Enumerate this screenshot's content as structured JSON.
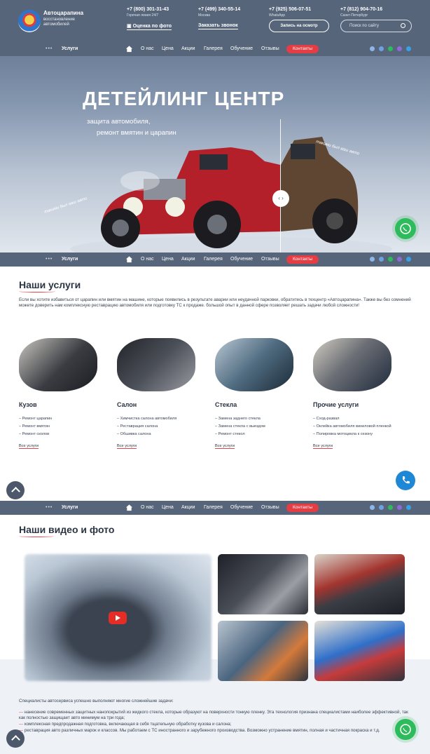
{
  "header": {
    "brand_name": "Автоцарапина",
    "brand_sub": "восстановление автомобилей",
    "phones": [
      {
        "number": "+7 (800) 301-31-43",
        "note": "Горячая линия 24/7"
      },
      {
        "number": "+7 (499) 340-55-14",
        "note": "Москва"
      },
      {
        "number": "+7 (925) 506-07-51",
        "note": "WhatsApp"
      },
      {
        "number": "+7 (812) 904-70-16",
        "note": "Санкт-Петербург"
      }
    ],
    "photo_estimate": "Оценка по фото",
    "callback": "Заказать звонок",
    "appointment_button": "Запись на осмотр",
    "search_placeholder": "Поиск по сайту"
  },
  "nav": {
    "dots": "•••",
    "services": "Услуги",
    "items": [
      "О нас",
      "Цена",
      "Акции",
      "Галерея",
      "Обучение",
      "Отзывы"
    ],
    "contacts": "Контакты"
  },
  "hero": {
    "title": "ДЕТЕЙЛИНГ ЦЕНТР",
    "subtitle1": "защита автомобиля,",
    "subtitle2": "ремонт вмятин и царапин",
    "handwriting_left": "такими был ваш авто",
    "handwriting_right": "такими был ваш авто",
    "slider_label": "‹ ›"
  },
  "services": {
    "title": "Наши услуги",
    "intro": "Если вы хотите избавиться от царапин или вмятин на машине, которые появились в результате аварии или неудачной парковки, обратитесь в техцентр «Автоцарапина». Также вы без сомнений можете доверить нам комплексную реставрацию автомобиля или подготовку ТС к продаже. большой опыт в данной сфере позволяет решать задачи любой сложности!",
    "cards": [
      {
        "title": "Кузов",
        "items": [
          "Ремонт царапин",
          "Ремонт вмятин",
          "Ремонт сколов"
        ],
        "link": "Все услуги"
      },
      {
        "title": "Салон",
        "items": [
          "Химчистка салона автомобиля",
          "Реставрация салона",
          "Обшивка салона"
        ],
        "link": "Все услуги"
      },
      {
        "title": "Стекла",
        "items": [
          "Замена заднего стекла",
          "Замена стекла с выездом",
          "Ремонт стекол"
        ],
        "link": "Все услуги"
      },
      {
        "title": "Прочие услуги",
        "items": [
          "Сход-развал",
          "Оклейка автомобиля виниловой пленкой",
          "Полировка мотоцикла к сезону"
        ],
        "link": "Все услуги"
      }
    ]
  },
  "gallery": {
    "title": "Наши видео и фото"
  },
  "bottom": {
    "lead": "Специалисты автосервиса успешно выполняют многие сложнейшие задачи:",
    "bullets": [
      "нанесение современных защитных нанопокрытий из жидкого стекла, которые образуют на поверхности тонкую пленку. Эта технология признана специалистами наиболее эффективной, так как полностью защищает авто минимум на три года;",
      "комплексная предпродажная подготовка, включающая в себя тщательную обработку кузова и салона;",
      "реставрация авто различных марок и классов. Мы работаем с ТС иностранного и зарубежного производства. Возможно устранение вмятин, полная и частичная покраска и т.д."
    ]
  },
  "colors": {
    "accent": "#e6434d",
    "header": "#56657a",
    "whatsapp": "#2dbb5b",
    "phone": "#1e88d6"
  }
}
